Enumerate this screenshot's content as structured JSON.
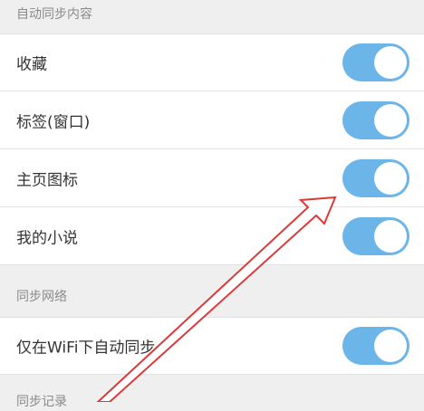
{
  "sections": [
    {
      "header": "自动同步内容",
      "items": [
        {
          "label": "收藏",
          "on": true
        },
        {
          "label": "标签(窗口)",
          "on": true
        },
        {
          "label": "主页图标",
          "on": true
        },
        {
          "label": "我的小说",
          "on": true
        }
      ]
    },
    {
      "header": "同步网络",
      "items": [
        {
          "label": "仅在WiFi下自动同步",
          "on": true
        }
      ]
    },
    {
      "header": "同步记录",
      "items": []
    }
  ],
  "colors": {
    "toggle_on": "#6cb5e8",
    "arrow": "#d93a3a",
    "background": "#efeff0"
  }
}
